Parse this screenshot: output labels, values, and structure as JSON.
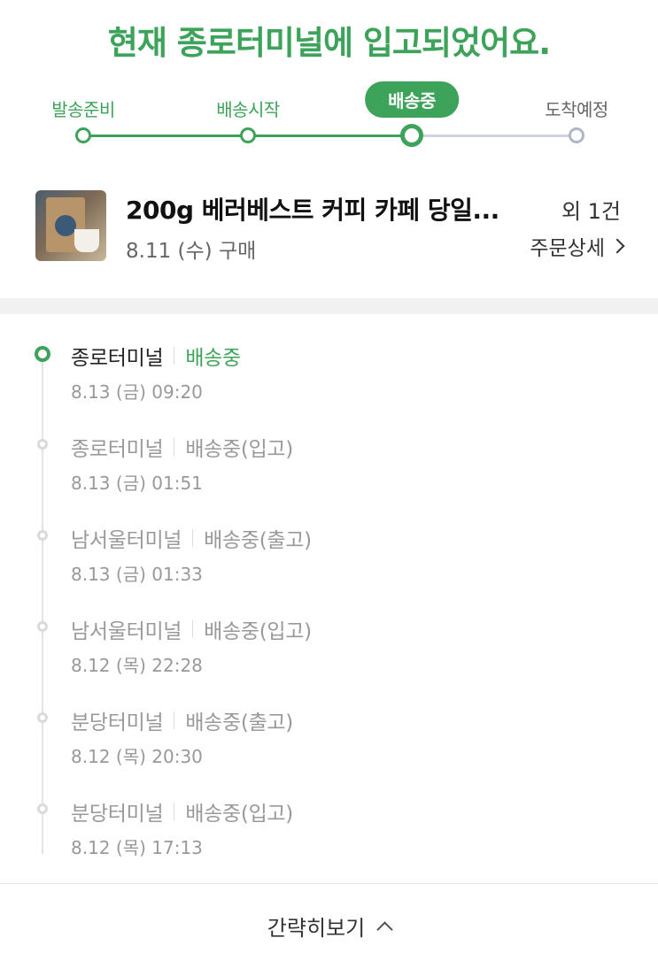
{
  "headline": "현재 종로터미널에 입고되었어요.",
  "stepper": {
    "steps": [
      {
        "label": "발송준비",
        "state": "done"
      },
      {
        "label": "배송시작",
        "state": "done"
      },
      {
        "label": "배송중",
        "state": "current"
      },
      {
        "label": "도착예정",
        "state": "future"
      }
    ]
  },
  "product": {
    "title": "200g 베러베스트 커피 카페 당일...",
    "extra": "외 1건",
    "purchase_date": "8.11 (수) 구매",
    "order_detail_label": "주문상세"
  },
  "timeline": [
    {
      "place": "종로터미널",
      "status": "배송중",
      "time": "8.13 (금) 09:20",
      "active": true
    },
    {
      "place": "종로터미널",
      "status": "배송중(입고)",
      "time": "8.13 (금) 01:51",
      "active": false
    },
    {
      "place": "남서울터미널",
      "status": "배송중(출고)",
      "time": "8.13 (금) 01:33",
      "active": false
    },
    {
      "place": "남서울터미널",
      "status": "배송중(입고)",
      "time": "8.12 (목) 22:28",
      "active": false
    },
    {
      "place": "분당터미널",
      "status": "배송중(출고)",
      "time": "8.12 (목) 20:30",
      "active": false
    },
    {
      "place": "분당터미널",
      "status": "배송중(입고)",
      "time": "8.12 (목) 17:13",
      "active": false
    }
  ],
  "footer": {
    "collapse_label": "간략히보기"
  },
  "colors": {
    "accent": "#3ea35a",
    "inactive": "#b0b6c8"
  }
}
